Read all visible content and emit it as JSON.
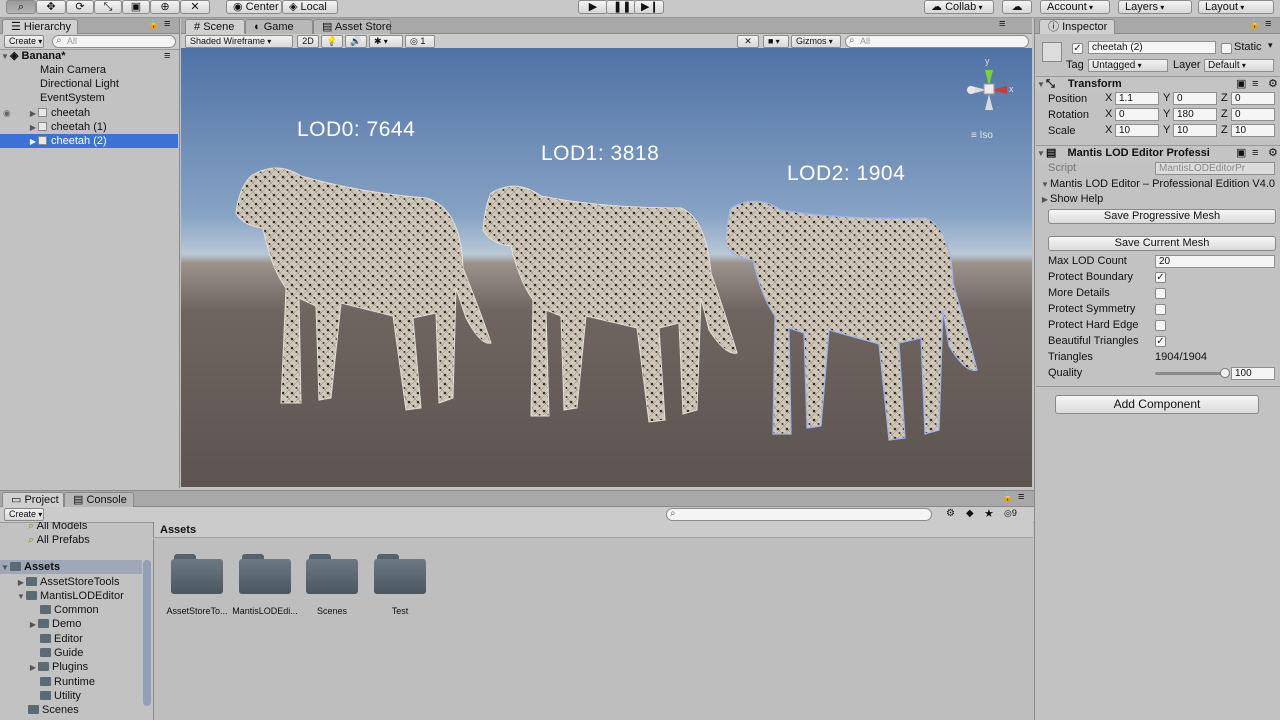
{
  "toolbar": {
    "center_label": "Center",
    "local_label": "Local",
    "collab_label": "Collab",
    "account_label": "Account",
    "layers_label": "Layers",
    "layout_label": "Layout"
  },
  "hierarchy": {
    "tab": "Hierarchy",
    "create_label": "Create",
    "search_placeholder": "All",
    "scene_name": "Banana*",
    "items": [
      {
        "label": "Main Camera"
      },
      {
        "label": "Directional Light"
      },
      {
        "label": "EventSystem"
      },
      {
        "label": "cheetah"
      },
      {
        "label": "cheetah (1)"
      },
      {
        "label": "cheetah (2)"
      }
    ]
  },
  "scene": {
    "tabs": [
      "Scene",
      "Game",
      "Asset Store"
    ],
    "shading": "Shaded Wireframe",
    "mode_2d": "2D",
    "layers_count": "1",
    "gizmos": "Gizmos",
    "search_placeholder": "All",
    "iso_label": "Iso",
    "axis": {
      "y": "y",
      "x": "x"
    },
    "lod_labels": [
      "LOD0: 7644",
      "LOD1: 3818",
      "LOD2: 1904"
    ]
  },
  "inspector": {
    "tab": "Inspector",
    "object_name": "cheetah (2)",
    "static_label": "Static",
    "tag_label": "Tag",
    "tag_value": "Untagged",
    "layer_label": "Layer",
    "layer_value": "Default",
    "transform": {
      "title": "Transform",
      "rows": [
        {
          "label": "Position",
          "x": "1.1",
          "y": "0",
          "z": "0"
        },
        {
          "label": "Rotation",
          "x": "0",
          "y": "180",
          "z": "0"
        },
        {
          "label": "Scale",
          "x": "10",
          "y": "10",
          "z": "10"
        }
      ],
      "axis_x": "X",
      "axis_y": "Y",
      "axis_z": "Z"
    },
    "mantis": {
      "title": "Mantis LOD Editor Professi",
      "script_label": "Script",
      "script_value": "MantisLODEditorPr",
      "edition": "Mantis LOD Editor – Professional Edition V4.0",
      "show_help": "Show Help",
      "save_progressive": "Save Progressive Mesh",
      "save_current": "Save Current Mesh",
      "max_lod_label": "Max LOD Count",
      "max_lod_value": "20",
      "toggles": [
        {
          "label": "Protect Boundary",
          "checked": true
        },
        {
          "label": "More Details",
          "checked": false
        },
        {
          "label": "Protect Symmetry",
          "checked": false
        },
        {
          "label": "Protect Hard Edge",
          "checked": false
        },
        {
          "label": "Beautiful Triangles",
          "checked": true
        }
      ],
      "triangles_label": "Triangles",
      "triangles_value": "1904/1904",
      "quality_label": "Quality",
      "quality_value": "100",
      "quality_level": 1.0
    },
    "add_component": "Add Component"
  },
  "project": {
    "tabs": [
      "Project",
      "Console"
    ],
    "create_label": "Create",
    "layers_count": "9",
    "favorites": [
      "All Models",
      "All Prefabs"
    ],
    "tree": [
      {
        "label": "Assets",
        "depth": 0
      },
      {
        "label": "AssetStoreTools",
        "depth": 1
      },
      {
        "label": "MantisLODEditor",
        "depth": 1
      },
      {
        "label": "Common",
        "depth": 2
      },
      {
        "label": "Demo",
        "depth": 2
      },
      {
        "label": "Editor",
        "depth": 2
      },
      {
        "label": "Guide",
        "depth": 2
      },
      {
        "label": "Plugins",
        "depth": 2
      },
      {
        "label": "Runtime",
        "depth": 2
      },
      {
        "label": "Utility",
        "depth": 2
      },
      {
        "label": "Scenes",
        "depth": 1
      }
    ],
    "breadcrumb": "Assets",
    "folders": [
      "AssetStoreTo...",
      "MantisLODEdi...",
      "Scenes",
      "Test"
    ]
  }
}
